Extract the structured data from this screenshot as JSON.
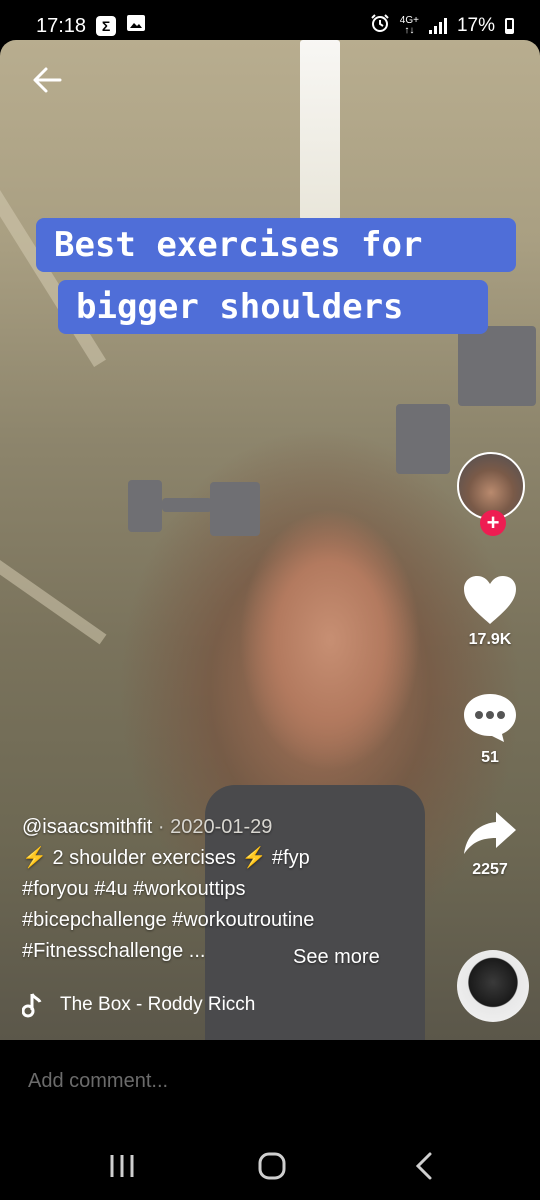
{
  "status_bar": {
    "time": "17:18",
    "notification_icons": [
      "sigma-icon",
      "image-icon"
    ],
    "alarm_icon": "alarm-icon",
    "network": "4G+",
    "battery": "17%"
  },
  "video": {
    "overlay_caption": [
      "Best exercises for",
      "bigger shoulders"
    ]
  },
  "sidebar": {
    "likes": "17.9K",
    "comments": "51",
    "shares": "2257"
  },
  "post": {
    "username": "@isaacsmithfit",
    "date_separator": " · ",
    "date": "2020-01-29",
    "description_lines": [
      "⚡ 2 shoulder exercises ⚡  #fyp",
      "#foryou #4u #workouttips",
      "#bicepchallenge #workoutroutine",
      "#Fitnesschallenge ..."
    ],
    "see_more": "See more",
    "music": "The Box - Roddy Ricch"
  },
  "comment_bar": {
    "placeholder": "Add comment..."
  },
  "colors": {
    "caption_bg": "#4f6ed8",
    "follow_badge": "#ee1d52",
    "lightning": "#f5c518"
  }
}
